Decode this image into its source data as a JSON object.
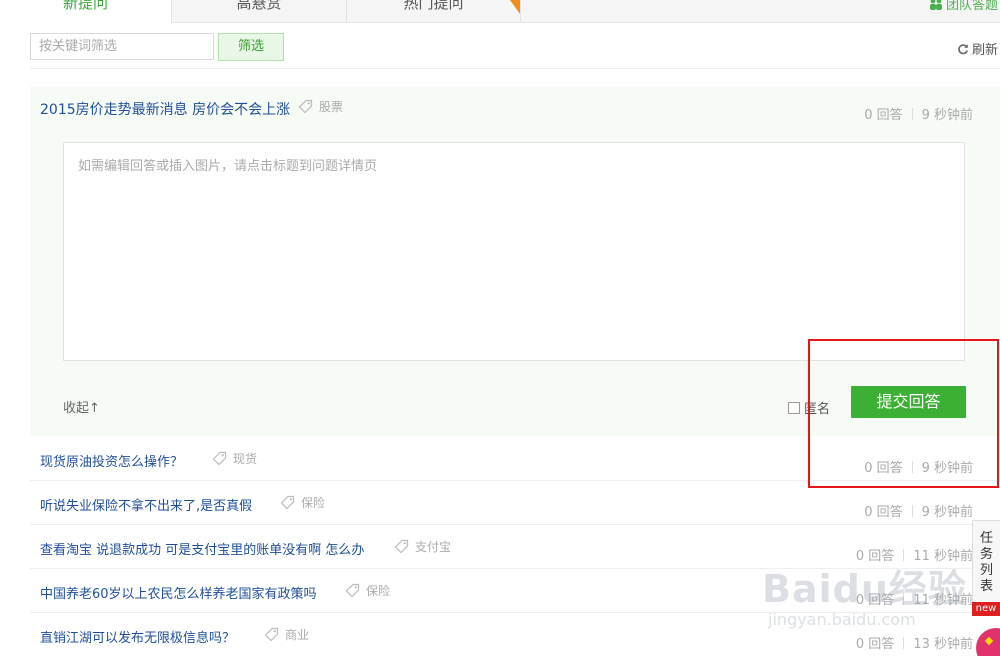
{
  "tabs": [
    {
      "label": "新提问",
      "active": true
    },
    {
      "label": "高悬赏",
      "active": false
    },
    {
      "label": "热门提问",
      "active": false
    }
  ],
  "team_label": "团队答题",
  "filter": {
    "placeholder": "按关键词筛选",
    "button": "筛选",
    "refresh": "刷新"
  },
  "expanded_question": {
    "title": "2015房价走势最新消息 房价会不会上涨",
    "tag": "股票",
    "answers": "0 回答",
    "time": "9 秒钟前",
    "editor_placeholder": "如需编辑回答或插入图片，请点击标题到问题详情页",
    "collapse": "收起↑",
    "anonymous": "匿名",
    "submit": "提交回答"
  },
  "questions": [
    {
      "title": "现货原油投资怎么操作？",
      "tag": "现货",
      "answers": "0 回答",
      "time": "9 秒钟前"
    },
    {
      "title": "听说失业保险不拿不出来了,是否真假",
      "tag": "保险",
      "answers": "0 回答",
      "time": "9 秒钟前"
    },
    {
      "title": "查看淘宝 说退款成功 可是支付宝里的账单没有啊 怎么办",
      "tag": "支付宝",
      "answers": "0 回答",
      "time": "11 秒钟前"
    },
    {
      "title": "中国养老60岁以上农民怎么样养老国家有政策吗",
      "tag": "保险",
      "answers": "0 回答",
      "time": "11 秒钟前"
    },
    {
      "title": "直销江湖可以发布无限极信息吗？",
      "tag": "商业",
      "answers": "0 回答",
      "time": "13 秒钟前"
    }
  ],
  "task_list": {
    "label": "任务列表",
    "badge": "new"
  },
  "watermark": {
    "logo": "Baidu经验",
    "url": "jingyan.baidu.com"
  },
  "colors": {
    "accent_green": "#3cb034",
    "link_blue": "#1f4f99",
    "highlight_red": "#e8141b",
    "panel_bg": "#f7fbf5"
  }
}
